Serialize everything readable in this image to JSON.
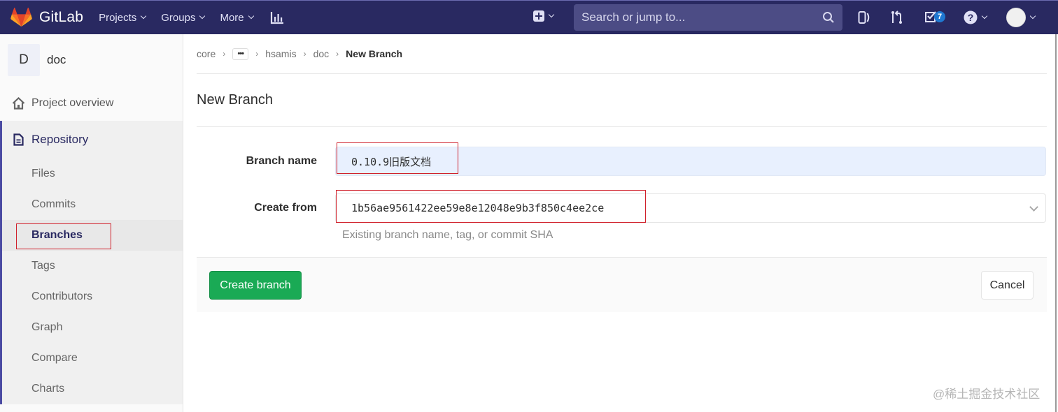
{
  "header": {
    "brand": "GitLab",
    "nav": [
      {
        "label": "Projects"
      },
      {
        "label": "Groups"
      },
      {
        "label": "More"
      }
    ],
    "search_placeholder": "Search or jump to...",
    "todos_count": "7",
    "colors": {
      "bar": "#292961",
      "badge": "#1f78d1"
    }
  },
  "sidebar": {
    "project_initial": "D",
    "project_name": "doc",
    "overview_label": "Project overview",
    "repository_label": "Repository",
    "repo_items": [
      {
        "label": "Files"
      },
      {
        "label": "Commits"
      },
      {
        "label": "Branches",
        "active": true
      },
      {
        "label": "Tags"
      },
      {
        "label": "Contributors"
      },
      {
        "label": "Graph"
      },
      {
        "label": "Compare"
      },
      {
        "label": "Charts"
      }
    ]
  },
  "breadcrumb": {
    "items": [
      "core",
      "hsamis",
      "doc"
    ],
    "current": "New Branch"
  },
  "page": {
    "title": "New Branch",
    "branch_name_label": "Branch name",
    "branch_name_value": "0.10.9旧版文档",
    "create_from_label": "Create from",
    "create_from_value": "1b56ae9561422ee59e8e12048e9b3f850c4ee2ce",
    "create_from_help": "Existing branch name, tag, or commit SHA",
    "create_button": "Create branch",
    "cancel_button": "Cancel",
    "colors": {
      "primary": "#1aaa55",
      "highlight": "#d0202b"
    }
  },
  "watermark": "@稀土掘金技术社区"
}
